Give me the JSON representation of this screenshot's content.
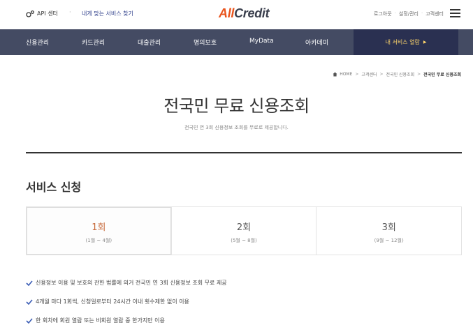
{
  "topbar": {
    "api_center": "API 센터",
    "find_service": "내게 맞는 서비스 찾기",
    "logo_all": "All",
    "logo_credit": "Credit",
    "util": [
      "로그아웃",
      "설정/관리",
      "고객센터"
    ]
  },
  "nav": {
    "items": [
      "신용관리",
      "카드관리",
      "대출관리",
      "명의보호",
      "MyData",
      "아카데미"
    ],
    "cta": "내 서비스 열람"
  },
  "breadcrumb": [
    "HOME",
    "고객센터",
    "전국민 신용조회",
    "전국민 무료 신용조회"
  ],
  "page": {
    "title": "전국민 무료 신용조회",
    "subtitle": "전국민 연 3회 신용정보 조회를 무료로 제공합니다."
  },
  "service": {
    "title": "서비스 신청",
    "tabs": [
      {
        "name": "1회",
        "range": "(1월 ~ 4월)"
      },
      {
        "name": "2회",
        "range": "(5월 ~ 8월)"
      },
      {
        "name": "3회",
        "range": "(9월 ~ 12월)"
      }
    ],
    "active_tab": 0
  },
  "bullets": [
    "신용정보 이용 및 보호의 관한 법률에 의거 전국민 연 3회 신용정보 조회 무료 제공",
    "4개월 마다 1회씩, 신청일로부터 24시간 이내 횟수제한 없이 이용",
    "한 회차에 회원 열람 또는 비회원 열람 중 한가지만 이용"
  ],
  "colors": {
    "nav_bg": "#444b63",
    "cta_bg": "#2a3051",
    "cta_text": "#ffd66b",
    "logo_accent": "#e9541d",
    "check": "#3b5db5",
    "active_tab": "#c7693a"
  },
  "icons": [
    "api-icon",
    "home-icon",
    "menu-icon",
    "check-icon",
    "triangle-right-icon"
  ]
}
